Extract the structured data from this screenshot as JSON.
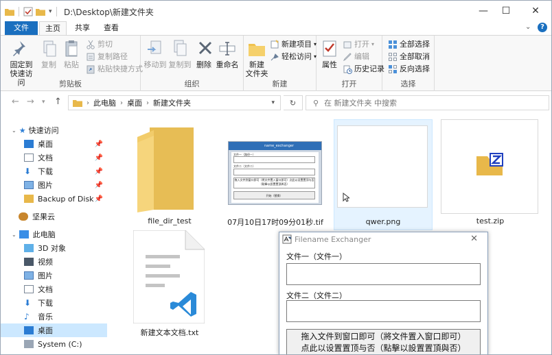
{
  "window": {
    "path_title": "D:\\Desktop\\新建文件夹",
    "minimize": "—",
    "maximize": "☐",
    "close": "✕"
  },
  "tabs": {
    "file": "文件",
    "home": "主页",
    "share": "共享",
    "view": "查看"
  },
  "ribbon": {
    "clipboard": {
      "label": "剪贴板",
      "pin": "固定到\n快速访问",
      "pin_l1": "固定到",
      "pin_l2": "快速访问",
      "copy": "复制",
      "paste": "粘贴",
      "cut": "剪切",
      "copy_path": "复制路径",
      "paste_shortcut": "粘贴快捷方式"
    },
    "organize": {
      "label": "组织",
      "move_to": "移动到",
      "copy_to": "复制到",
      "delete": "删除",
      "rename": "重命名"
    },
    "new": {
      "label": "新建",
      "new_folder_l1": "新建",
      "new_folder_l2": "文件夹",
      "new_item": "新建项目",
      "easy_access": "轻松访问"
    },
    "open": {
      "label": "打开",
      "properties": "属性",
      "open": "打开",
      "edit": "编辑",
      "history": "历史记录"
    },
    "select": {
      "label": "选择",
      "select_all": "全部选择",
      "select_none": "全部取消",
      "invert": "反向选择"
    }
  },
  "address": {
    "crumbs": [
      "此电脑",
      "桌面",
      "新建文件夹"
    ],
    "search_placeholder": "在 新建文件夹 中搜索"
  },
  "nav": {
    "quick_access": "快速访问",
    "items": [
      {
        "label": "桌面",
        "pinned": true
      },
      {
        "label": "文档",
        "pinned": true
      },
      {
        "label": "下载",
        "pinned": true
      },
      {
        "label": "图片",
        "pinned": true
      },
      {
        "label": "Backup of Disk",
        "pinned": true
      }
    ],
    "jianguoyun": "坚果云",
    "this_pc": "此电脑",
    "pc_items": [
      "3D 对象",
      "视频",
      "图片",
      "文档",
      "下载",
      "音乐",
      "桌面",
      "System (C:)"
    ]
  },
  "files": [
    {
      "name": "file_dir_test",
      "type": "folder"
    },
    {
      "name": "07月10日17时09分01秒.tif",
      "type": "image"
    },
    {
      "name": "qwer.png",
      "type": "image"
    },
    {
      "name": "test.zip",
      "type": "zip"
    },
    {
      "name": "新建文本文档.txt",
      "type": "text"
    }
  ],
  "thumb_app": {
    "title": "name_exchanger",
    "label1": "文件一（路径一）",
    "label2": "文件二（文件二）",
    "hint": "拖入文件到窗口即可（将文件置入窗口即可）点此以设置置顶与否（點擊以設置置頂與否）",
    "start": "开始（替换）"
  },
  "dialog": {
    "title": "Filename Exchanger",
    "file1_label": "文件一（文件一）",
    "file2_label": "文件二（文件二）",
    "hint_line1": "拖入文件到窗口即可（將文件置入窗口即可）",
    "hint_line2": "点此以设置置顶与否（點擊以設置置頂與否）"
  }
}
